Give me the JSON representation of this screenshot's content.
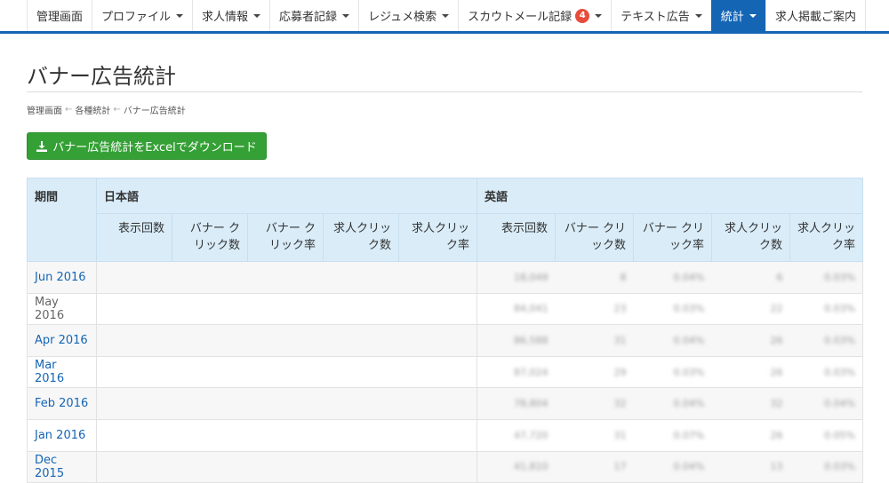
{
  "nav": {
    "items": [
      {
        "label": "管理画面",
        "caret": false
      },
      {
        "label": "プロファイル",
        "caret": true
      },
      {
        "label": "求人情報",
        "caret": true
      },
      {
        "label": "応募者記録",
        "caret": true
      },
      {
        "label": "レジュメ検索",
        "caret": true
      },
      {
        "label": "スカウトメール記録",
        "caret": true,
        "badge": "4"
      },
      {
        "label": "テキスト広告",
        "caret": true
      },
      {
        "label": "統計",
        "caret": true,
        "active": true
      }
    ],
    "right_item": "求人掲載ご案内"
  },
  "page_title": "バナー広告統計",
  "breadcrumb": [
    "管理画面",
    "各種統計",
    "バナー広告統計"
  ],
  "breadcrumb_sep": "←",
  "download_button": "バナー広告統計をExcelでダウンロード",
  "colors": {
    "nav_accent": "#1565b5",
    "button_green": "#35a035",
    "header_bg": "#d9ecf8",
    "badge": "#e74c3c"
  },
  "table": {
    "period_header": "期間",
    "groups": [
      "日本語",
      "英語"
    ],
    "sub_headers_ja": [
      "表示回数",
      "バナー クリック数",
      "バナー クリック率",
      "求人クリック数",
      "求人クリック率"
    ],
    "sub_headers_en": [
      "表示回数",
      "バナー クリック数",
      "バナー クリック率",
      "求人クリック数",
      "求人クリック率"
    ],
    "rows": [
      {
        "period": "Jun 2016",
        "link": true,
        "en": [
          "18,049",
          "8",
          "0.04%",
          "6",
          "0.03%"
        ]
      },
      {
        "period": "May 2016",
        "link": false,
        "en": [
          "84,041",
          "23",
          "0.03%",
          "22",
          "0.03%"
        ]
      },
      {
        "period": "Apr 2016",
        "link": true,
        "en": [
          "86,588",
          "31",
          "0.04%",
          "26",
          "0.03%"
        ]
      },
      {
        "period": "Mar 2016",
        "link": true,
        "en": [
          "87,024",
          "29",
          "0.03%",
          "26",
          "0.03%"
        ]
      },
      {
        "period": "Feb 2016",
        "link": true,
        "en": [
          "78,804",
          "32",
          "0.04%",
          "32",
          "0.04%"
        ]
      },
      {
        "period": "Jan 2016",
        "link": true,
        "en": [
          "47,720",
          "31",
          "0.07%",
          "26",
          "0.05%"
        ]
      },
      {
        "period": "Dec 2015",
        "link": true,
        "en": [
          "41,810",
          "17",
          "0.04%",
          "13",
          "0.03%"
        ]
      }
    ]
  }
}
